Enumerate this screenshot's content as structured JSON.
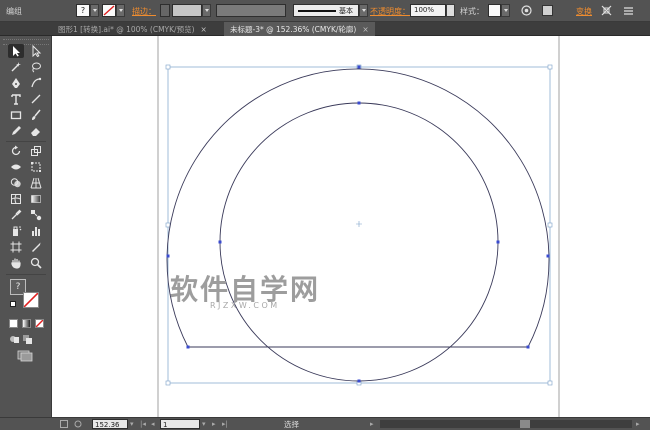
{
  "menu": {
    "edit_label": "编组"
  },
  "control_bar": {
    "fill_value": "?",
    "stroke_label": "描边：",
    "stroke_style_label": "基本",
    "opacity_label": "不透明度：",
    "opacity_value": "100%",
    "style_label": "样式：",
    "transform_label": "变换"
  },
  "tabs": [
    {
      "label": "图形1 [转换].ai* @ 100% (CMYK/预览)",
      "close": "×",
      "active": false
    },
    {
      "label": "未标题-3* @ 152.36% (CMYK/轮廓)",
      "close": "×",
      "active": true
    }
  ],
  "tools_panel": {
    "fill_stroke_unknown": "?",
    "tools": [
      "selection-tool-icon",
      "direct-selection-tool-icon",
      "magic-wand-tool-icon",
      "lasso-tool-icon",
      "pen-tool-icon",
      "curvature-tool-icon",
      "type-tool-icon",
      "line-segment-tool-icon",
      "rectangle-tool-icon",
      "paintbrush-tool-icon",
      "pencil-tool-icon",
      "eraser-tool-icon",
      "rotate-tool-icon",
      "scale-tool-icon",
      "width-tool-icon",
      "free-transform-tool-icon",
      "shape-builder-tool-icon",
      "perspective-grid-tool-icon",
      "mesh-tool-icon",
      "gradient-tool-icon",
      "eyedropper-tool-icon",
      "blend-tool-icon",
      "symbol-sprayer-tool-icon",
      "column-graph-tool-icon",
      "artboard-tool-icon",
      "slice-tool-icon",
      "hand-tool-icon",
      "zoom-tool-icon"
    ]
  },
  "watermark": {
    "main": "软件自学网",
    "sub": "RJZXW.COM"
  },
  "status_bar": {
    "zoom_value": "152.36",
    "page_value": "1",
    "current_tool": "选择"
  },
  "colors": {
    "ui_background": "#535353",
    "tab_bar": "#3d3d3d",
    "canvas": "#ffffff",
    "accent_orange": "#f08d2f",
    "outline_path": "#3a3a5a",
    "anchor_point": "#3a4bd0"
  }
}
